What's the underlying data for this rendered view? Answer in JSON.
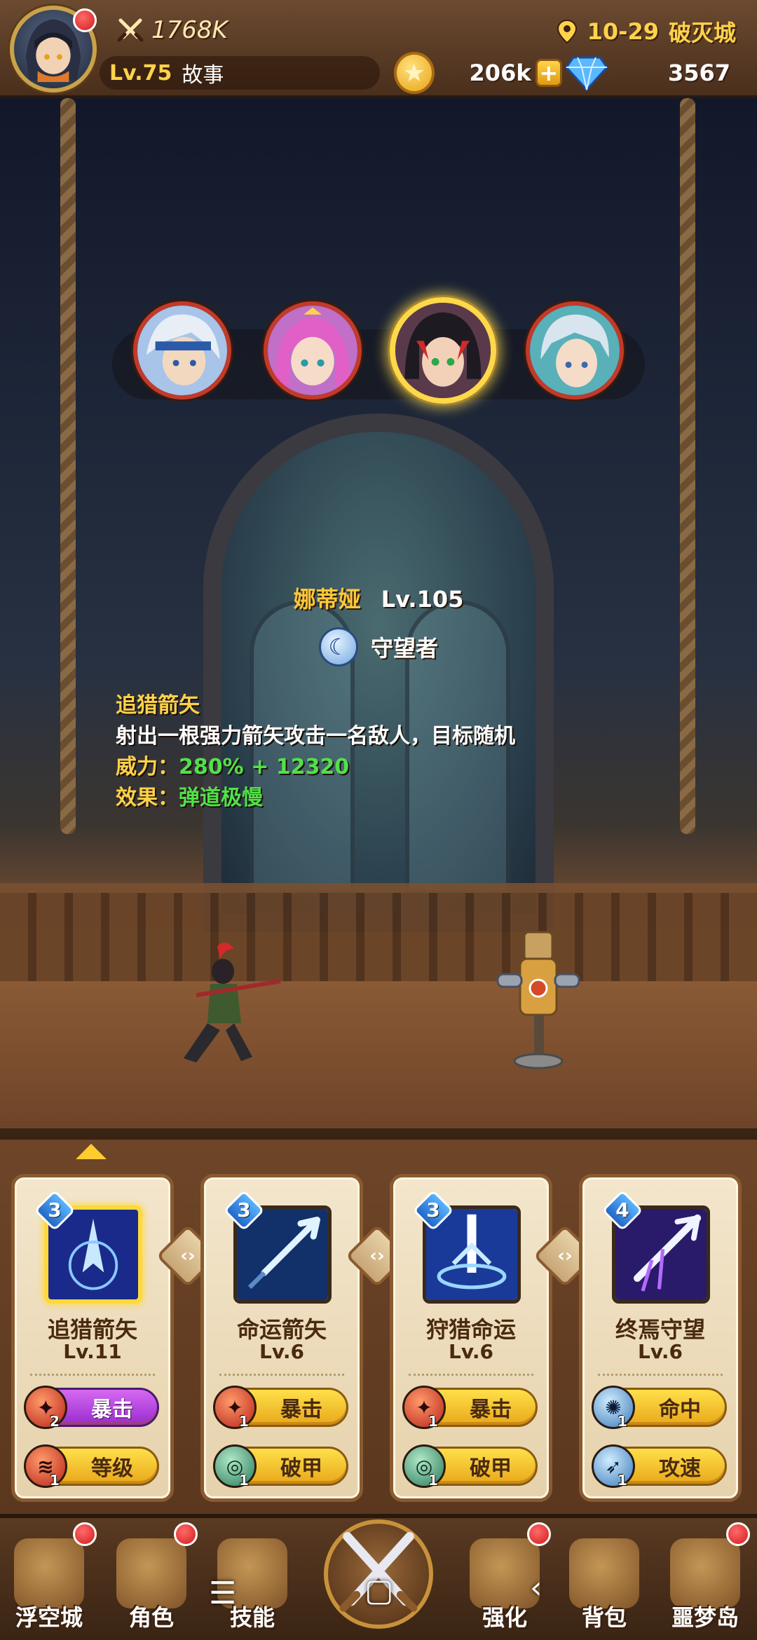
{
  "header": {
    "power": "1768K",
    "level": "Lv.75",
    "story_label": "故事",
    "stage": "10-29",
    "location_name": "破灭城",
    "gold": "206k",
    "gold_add": "+",
    "gems": "3567"
  },
  "heroes": [
    {
      "name": "hero-1",
      "selected": false
    },
    {
      "name": "hero-2",
      "selected": false
    },
    {
      "name": "hero-3",
      "selected": true
    },
    {
      "name": "hero-4",
      "selected": false
    }
  ],
  "hero": {
    "name": "娜蒂娅",
    "level": "Lv.105",
    "class_name": "守望者",
    "class_icon": "moon-icon"
  },
  "skill_detail": {
    "title": "追猎箭矢",
    "description": "射出一根强力箭矢攻击一名敌人，目标随机",
    "power_label": "威力：",
    "power_value": "280% + 12320",
    "effect_label": "效果：",
    "effect_value": "弹道极慢"
  },
  "skills": [
    {
      "rank": "3",
      "name": "追猎箭矢",
      "level": "Lv.11",
      "rune1": {
        "label": "暴击",
        "count": "2",
        "icon": "red-rune-icon",
        "style": "purple"
      },
      "rune2": {
        "label": "等级",
        "count": "1",
        "icon": "red-rune-icon",
        "style": "gold"
      }
    },
    {
      "rank": "3",
      "name": "命运箭矢",
      "level": "Lv.6",
      "rune1": {
        "label": "暴击",
        "count": "1",
        "icon": "red-rune-icon",
        "style": "gold"
      },
      "rune2": {
        "label": "破甲",
        "count": "1",
        "icon": "green-rune-icon",
        "style": "gold"
      }
    },
    {
      "rank": "3",
      "name": "狩猎命运",
      "level": "Lv.6",
      "rune1": {
        "label": "暴击",
        "count": "1",
        "icon": "red-rune-icon",
        "style": "gold"
      },
      "rune2": {
        "label": "破甲",
        "count": "1",
        "icon": "green-rune-icon",
        "style": "gold"
      }
    },
    {
      "rank": "4",
      "name": "终焉守望",
      "level": "Lv.6",
      "rune1": {
        "label": "命中",
        "count": "1",
        "icon": "blue-rune-icon",
        "style": "gold"
      },
      "rune2": {
        "label": "攻速",
        "count": "1",
        "icon": "blue-rune-icon",
        "style": "gold"
      }
    }
  ],
  "swap_glyph": "‹›",
  "nav": [
    {
      "label": "浮空城",
      "badge": true
    },
    {
      "label": "角色",
      "badge": true
    },
    {
      "label": "技能",
      "badge": false
    },
    {
      "label": "强化",
      "badge": true
    },
    {
      "label": "背包",
      "badge": false
    },
    {
      "label": "噩梦岛",
      "badge": true
    }
  ],
  "system_nav": {
    "menu": "☰",
    "home": "▢",
    "back": "‹"
  },
  "colors": {
    "accent_gold": "#ffd24a",
    "value_green": "#52e04a",
    "badge_red": "#d11c1c",
    "rune_purple": "#9a2ad0"
  }
}
